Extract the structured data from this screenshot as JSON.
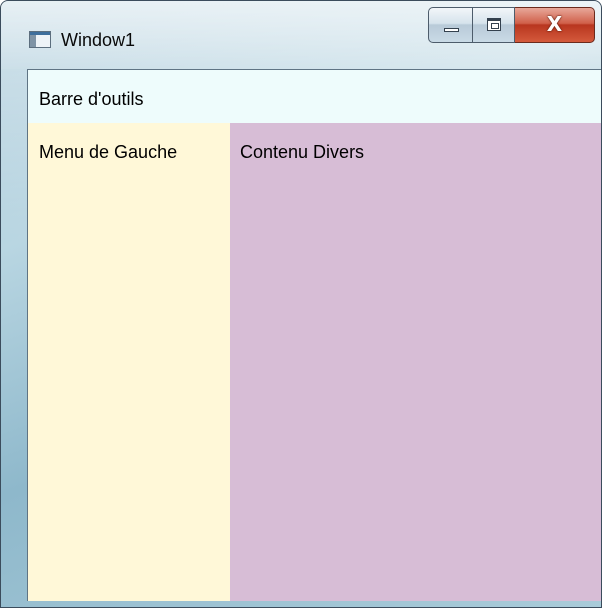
{
  "window": {
    "title": "Window1",
    "buttons": {
      "minimize": "minimize",
      "maximize": "maximize",
      "close": "close"
    },
    "close_glyph": "X"
  },
  "toolbar": {
    "label": "Barre d'outils",
    "background": "#eefcfc"
  },
  "left_menu": {
    "label": "Menu de Gauche",
    "background": "#fff8d8"
  },
  "content": {
    "label": "Contenu Divers",
    "background": "#d7bdd6"
  },
  "icons": {
    "app": "window-icon",
    "minimize": "minimize-icon",
    "maximize": "maximize-icon",
    "close": "close-icon"
  }
}
